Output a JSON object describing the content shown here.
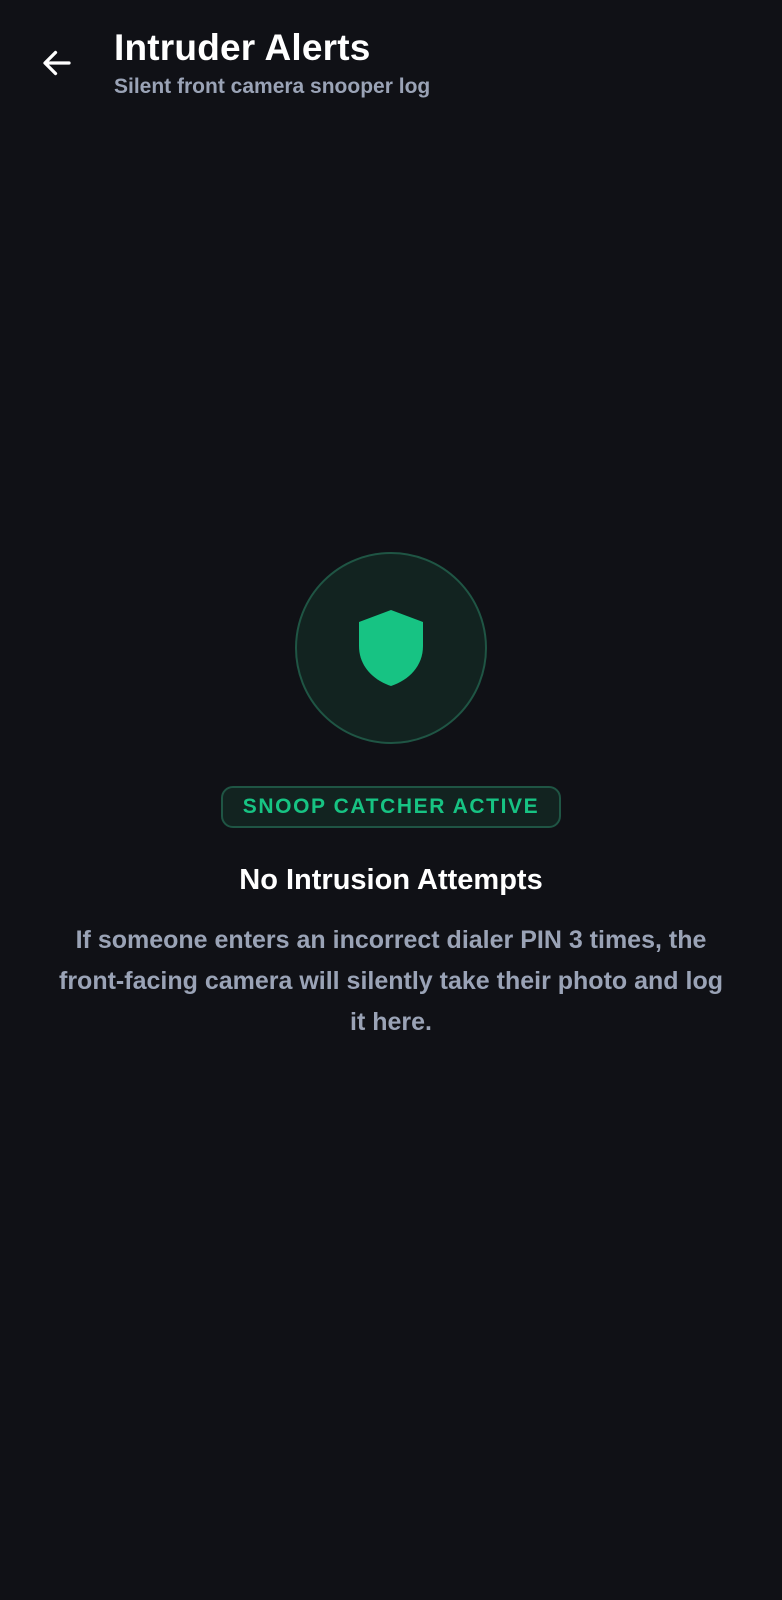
{
  "header": {
    "back_icon": "arrow-left-icon",
    "title": "Intruder Alerts",
    "subtitle": "Silent front camera snooper log"
  },
  "empty_state": {
    "icon": "shield-icon",
    "badge": "SNOOP CATCHER ACTIVE",
    "title": "No Intrusion Attempts",
    "description": "If someone enters an incorrect dialer PIN 3 times, the front-facing camera will silently take their photo and log it here."
  },
  "colors": {
    "background": "#101116",
    "accent": "#17c383",
    "muted_text": "#9aa3b6",
    "badge_border": "#1f5544"
  }
}
